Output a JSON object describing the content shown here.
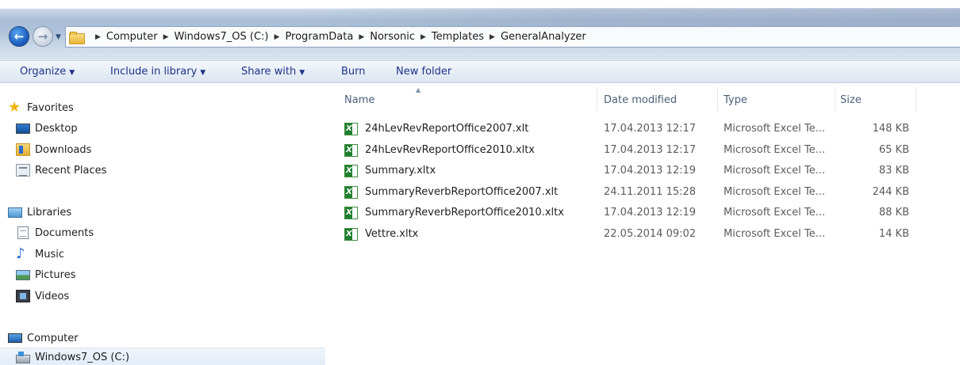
{
  "address_bar": {
    "breadcrumbs": [
      "Computer",
      "Windows7_OS (C:)",
      "ProgramData",
      "Norsonic",
      "Templates",
      "GeneralAnalyzer"
    ]
  },
  "toolbar": {
    "organize": "Organize",
    "include_in_library": "Include in library",
    "share_with": "Share with",
    "burn": "Burn",
    "new_folder": "New folder"
  },
  "nav_pane": {
    "favorites": {
      "label": "Favorites",
      "items": [
        "Desktop",
        "Downloads",
        "Recent Places"
      ]
    },
    "libraries": {
      "label": "Libraries",
      "items": [
        "Documents",
        "Music",
        "Pictures",
        "Videos"
      ]
    },
    "computer": {
      "label": "Computer",
      "items": [
        "Windows7_OS (C:)"
      ]
    }
  },
  "columns": {
    "name": "Name",
    "date_modified": "Date modified",
    "type": "Type",
    "size": "Size"
  },
  "files": [
    {
      "name": "24hLevRevReportOffice2007.xlt",
      "date": "17.04.2013 12:17",
      "type": "Microsoft Excel Te...",
      "size": "148 KB"
    },
    {
      "name": "24hLevRevReportOffice2010.xltx",
      "date": "17.04.2013 12:17",
      "type": "Microsoft Excel Te...",
      "size": "65 KB"
    },
    {
      "name": "Summary.xltx",
      "date": "17.04.2013 12:19",
      "type": "Microsoft Excel Te...",
      "size": "83 KB"
    },
    {
      "name": "SummaryReverbReportOffice2007.xlt",
      "date": "24.11.2011 15:28",
      "type": "Microsoft Excel Te...",
      "size": "244 KB"
    },
    {
      "name": "SummaryReverbReportOffice2010.xltx",
      "date": "17.04.2013 12:19",
      "type": "Microsoft Excel Te...",
      "size": "88 KB"
    },
    {
      "name": "Vettre.xltx",
      "date": "22.05.2014 09:02",
      "type": "Microsoft Excel Te...",
      "size": "14 KB"
    }
  ],
  "icons": {
    "back": "back-arrow-icon",
    "forward": "forward-arrow-icon",
    "excel": "excel-template-icon"
  }
}
